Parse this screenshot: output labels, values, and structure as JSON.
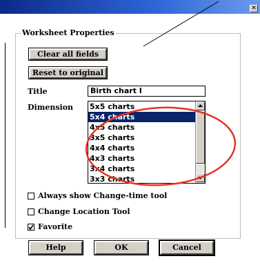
{
  "window": {
    "close_label": "✕"
  },
  "group": {
    "title": "Worksheet Properties"
  },
  "buttons": {
    "clear": "Clear all fields",
    "reset": "Reset to original"
  },
  "fields": {
    "title_label": "Title",
    "title_value": "Birth chart I",
    "dimension_label": "Dimension"
  },
  "dimension_list": {
    "items": [
      "5x5 charts",
      "5x4 charts",
      "4x5 charts",
      "3x5 charts",
      "4x4 charts",
      "4x3 charts",
      "3x4 charts",
      "3x3 charts"
    ],
    "selected_index": 1
  },
  "checkboxes": [
    {
      "label": "Always show Change-time tool",
      "checked": false
    },
    {
      "label": "Change Location Tool",
      "checked": false
    },
    {
      "label": "Favorite",
      "checked": true
    }
  ],
  "footer": {
    "help": "Help",
    "ok": "OK",
    "cancel": "Cancel"
  },
  "colors": {
    "selection": "#0a246a",
    "annotation": "#e8321e",
    "titlebar": "#2f66d8"
  }
}
